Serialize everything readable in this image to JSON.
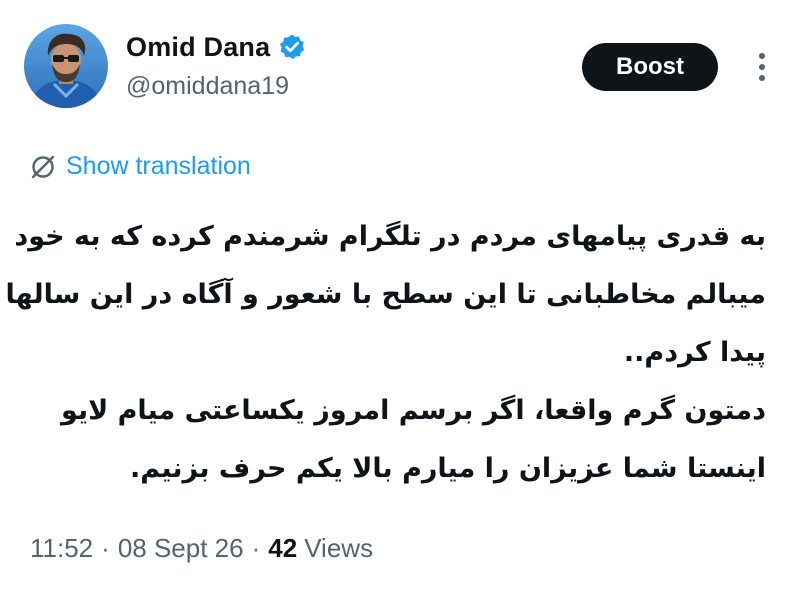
{
  "author": {
    "display_name": "Omid Dana",
    "handle": "@omiddana19",
    "verified": true,
    "avatar_icon": "profile-photo"
  },
  "actions": {
    "boost_label": "Boost",
    "more_icon": "vertical-ellipsis-icon"
  },
  "translation": {
    "icon": "translate-globe-icon",
    "label": "Show translation"
  },
  "tweet": {
    "lines": [
      "به قدری پیامهای مردم در تلگرام شرمندم کرده که به خود",
      "میبالم مخاطبانی تا این سطح با شعور و آگاه در این سالها",
      "پیدا کردم..",
      "دمتون گرم واقعا، اگر برسم امروز یکساعتی میام لایو",
      "اینستا شما عزیزان را میارم بالا یکم حرف بزنیم."
    ]
  },
  "meta": {
    "time": "11:52",
    "separator": "·",
    "date": "08 Sept 26",
    "views_count": "42",
    "views_label": "Views"
  },
  "colors": {
    "text_primary": "#0f1419",
    "text_secondary": "#536471",
    "link": "#1d9bf0",
    "verified_badge": "#1d9bf0",
    "boost_bg": "#0f1419"
  }
}
